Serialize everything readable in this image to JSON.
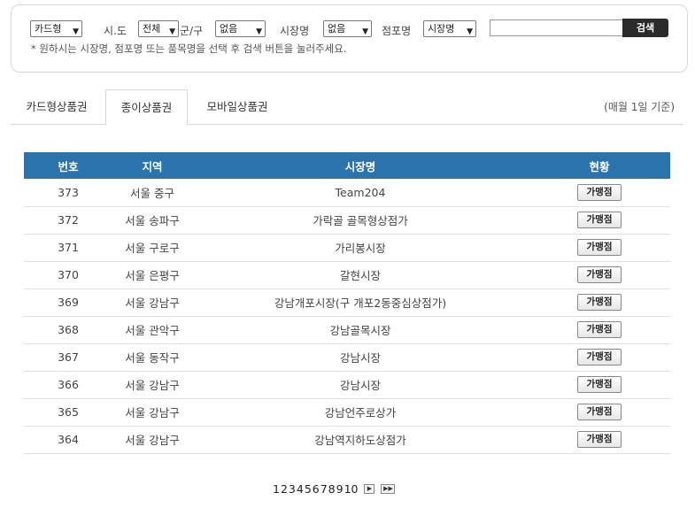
{
  "search": {
    "type_select": "카드형",
    "sido_label": "시.도",
    "sido_select": "전체",
    "gungu_label": "군/구",
    "gungu_select": "없음",
    "market_label": "시장명",
    "market_select": "없음",
    "shop_label": "점포명",
    "shop_select": "시장명",
    "keyword_value": "",
    "button_label": "검색",
    "hint": "* 원하시는 시장명, 점포명 또는 품목명을 선택 후 검색 버튼을 눌러주세요."
  },
  "tabs": {
    "items": [
      {
        "label": "카드형상품권"
      },
      {
        "label": "종이상품권"
      },
      {
        "label": "모바일상품권"
      }
    ],
    "active": 1,
    "note": "(매월 1일 기준)"
  },
  "table": {
    "headers": [
      "번호",
      "지역",
      "시장명",
      "현황"
    ],
    "rows": [
      {
        "no": "373",
        "region": "서울 중구",
        "market": "Team204",
        "status": "가맹점"
      },
      {
        "no": "372",
        "region": "서울 송파구",
        "market": "가락골 골목형상점가",
        "status": "가맹점"
      },
      {
        "no": "371",
        "region": "서울 구로구",
        "market": "가리봉시장",
        "status": "가맹점"
      },
      {
        "no": "370",
        "region": "서울 은평구",
        "market": "갈현시장",
        "status": "가맹점"
      },
      {
        "no": "369",
        "region": "서울 강남구",
        "market": "강남개포시장(구 개포2동중심상점가)",
        "status": "가맹점"
      },
      {
        "no": "368",
        "region": "서울 관악구",
        "market": "강남골목시장",
        "status": "가맹점"
      },
      {
        "no": "367",
        "region": "서울 동작구",
        "market": "강남시장",
        "status": "가맹점"
      },
      {
        "no": "366",
        "region": "서울 강남구",
        "market": "강남시장",
        "status": "가맹점"
      },
      {
        "no": "365",
        "region": "서울 강남구",
        "market": "강남언주로상가",
        "status": "가맹점"
      },
      {
        "no": "364",
        "region": "서울 강남구",
        "market": "강남역지하도상점가",
        "status": "가맹점"
      }
    ]
  },
  "pager": {
    "pages": [
      "1",
      "2",
      "3",
      "4",
      "5",
      "6",
      "7",
      "8",
      "9",
      "10"
    ],
    "next_icon": "next-page-icon",
    "last_icon": "last-page-icon"
  }
}
